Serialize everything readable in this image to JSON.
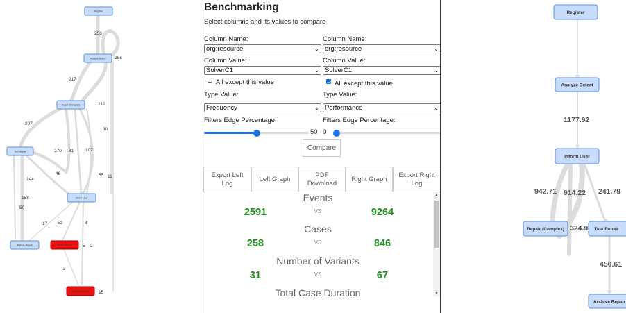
{
  "left_graph": {
    "nodes": {
      "register": "Register",
      "analyze_defect": "Analyze Defect",
      "repair_complex": "Repair (Complex)",
      "test_repair": "Test Repair",
      "inform_user": "Inform User",
      "archive_repair": "Archive Repair",
      "restart_repair": "Restart Repair",
      "repair_simple": "Repair (Simple)"
    },
    "edge_labels": [
      "258",
      "258",
      "217",
      "219",
      "30",
      "207",
      "270",
      "81",
      "107",
      "46",
      "55",
      "11",
      "144",
      "158",
      "50",
      "17",
      "52",
      "8",
      "5",
      "2",
      "3",
      "15"
    ]
  },
  "panel": {
    "title": "Benchmarking",
    "subtitle": "Select columns and its values to compare",
    "left": {
      "column_name_label": "Column Name:",
      "column_name_value": "org:resource",
      "column_value_label": "Column Value:",
      "column_value": "SolverC1",
      "except_label": "All except this value",
      "except_checked": false,
      "type_label": "Type Value:",
      "type_value": "Frequency",
      "filter_label": "Filters Edge Percentage:",
      "filter_value": "50",
      "filter_fraction": 0.5
    },
    "right": {
      "column_name_label": "Column Name:",
      "column_name_value": "org:resource",
      "column_value_label": "Column Value:",
      "column_value": "SolverC1",
      "except_label": "All except this value",
      "except_checked": true,
      "type_label": "Type Value:",
      "type_value": "Performance",
      "filter_label": "Filters Edge Percentage:",
      "filter_value": "0",
      "filter_fraction": 0
    },
    "compare_button": "Compare",
    "buttons": {
      "export_left_1": "Export Left",
      "export_left_2": "Log",
      "left_graph": "Left Graph",
      "pdf_1": "PDF",
      "pdf_2": "Download",
      "right_graph": "Right Graph",
      "export_right_1": "Export Right",
      "export_right_2": "Log"
    },
    "stats": {
      "vs": "VS",
      "events": {
        "title": "Events",
        "left": "2591",
        "right": "9264"
      },
      "cases": {
        "title": "Cases",
        "left": "258",
        "right": "846"
      },
      "variants": {
        "title": "Number of Variants",
        "left": "31",
        "right": "67"
      },
      "duration": {
        "title": "Total Case Duration"
      }
    }
  },
  "right_graph": {
    "nodes": {
      "register": "Register",
      "analyze_defect": "Analyze Defect",
      "inform_user": "Inform User",
      "repair_complex": "Repair (Complex)",
      "test_repair": "Test Repair",
      "archive_repair": "Archive Repair"
    },
    "edge_labels": [
      "1177.92",
      "942.71",
      "914.22",
      "241.79",
      "324.9",
      "450.61"
    ]
  },
  "colors": {
    "node_fill": "#c6dcfa",
    "node_stroke": "#5b8fd6",
    "node_red": "#ea1010",
    "edge": "#dcdcdc",
    "stat_value": "#1f8f1f",
    "accent": "#1a73e8"
  }
}
